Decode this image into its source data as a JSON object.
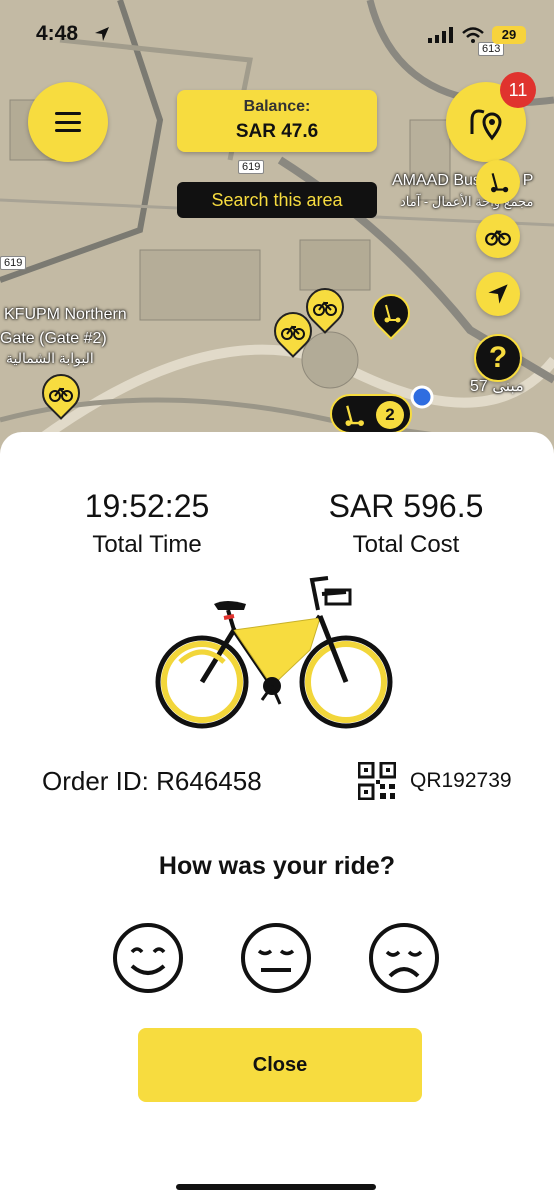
{
  "status_bar": {
    "time": "4:48",
    "battery": "29"
  },
  "map": {
    "balance_label": "Balance:",
    "balance_value": "SAR 47.6",
    "search_area": "Search this area",
    "notification_count": "11",
    "road_labels": [
      "613",
      "619",
      "619"
    ],
    "place_amaad": "AMAAD Business P",
    "place_amaad_ar": "مجمع واحة الأعمال - آماد",
    "place_kfupm_1": "KFUPM Northern",
    "place_kfupm_2": "Gate (Gate #2)",
    "place_kfupm_ar": "البوابة الشمالية",
    "place_building": "مبنى 57",
    "cluster_count": "2",
    "help_symbol": "?"
  },
  "ride_summary": {
    "total_time_value": "19:52:25",
    "total_time_label": "Total Time",
    "total_cost_value": "SAR 596.5",
    "total_cost_label": "Total Cost",
    "order_id": "Order ID: R646458",
    "qr_code": "QR192739",
    "rating_question": "How was your ride?",
    "ratings": [
      "happy",
      "neutral",
      "sad"
    ],
    "close_label": "Close"
  },
  "colors": {
    "accent": "#f7dc3f",
    "dark": "#111111",
    "badge": "#e0332e"
  }
}
